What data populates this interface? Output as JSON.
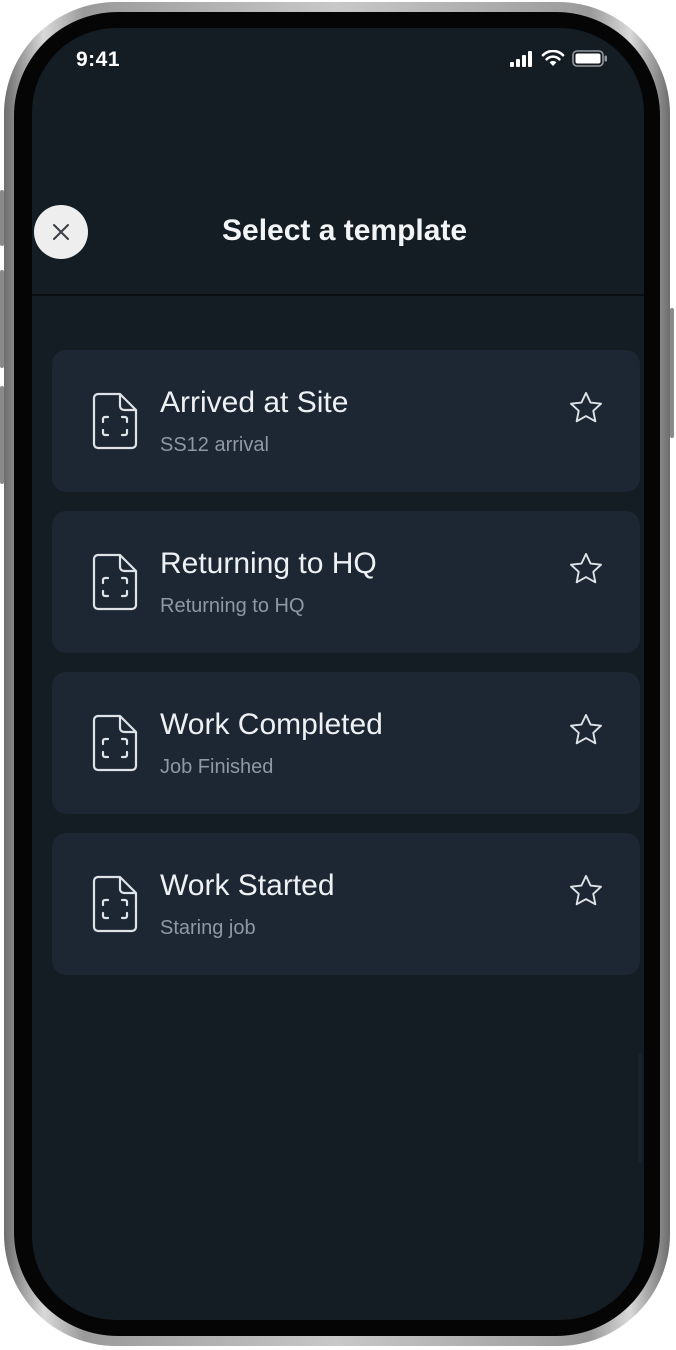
{
  "status_bar": {
    "time": "9:41"
  },
  "header": {
    "title": "Select a template",
    "close_icon": "close-icon"
  },
  "templates": [
    {
      "title": "Arrived at Site",
      "subtitle": "SS12 arrival",
      "icon": "document-icon",
      "favorite_icon": "star-outline-icon"
    },
    {
      "title": "Returning to HQ",
      "subtitle": "Returning to HQ",
      "icon": "document-icon",
      "favorite_icon": "star-outline-icon"
    },
    {
      "title": "Work Completed",
      "subtitle": "Job Finished",
      "icon": "document-icon",
      "favorite_icon": "star-outline-icon"
    },
    {
      "title": "Work Started",
      "subtitle": "Staring job",
      "icon": "document-icon",
      "favorite_icon": "star-outline-icon"
    }
  ],
  "colors": {
    "screen_background": "#141c24",
    "card_background": "#1c2733",
    "title_text": "#eef1f4",
    "subtitle_text": "#8f98a3",
    "close_button": "#eeeeee"
  }
}
